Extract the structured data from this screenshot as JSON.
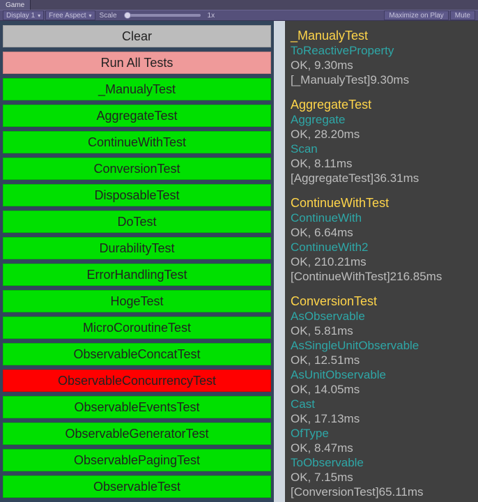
{
  "tabs": {
    "game_label": "Game"
  },
  "toolbar": {
    "display": "Display 1",
    "aspect": "Free Aspect",
    "scale_label": "Scale",
    "scale_value": "1x",
    "maximize": "Maximize on Play",
    "mute": "Mute"
  },
  "buttons": {
    "clear": "Clear",
    "run_all": "Run All Tests"
  },
  "tests": [
    {
      "label": "_ManualyTest",
      "status": "green"
    },
    {
      "label": "AggregateTest",
      "status": "green"
    },
    {
      "label": "ContinueWithTest",
      "status": "green"
    },
    {
      "label": "ConversionTest",
      "status": "green"
    },
    {
      "label": "DisposableTest",
      "status": "green"
    },
    {
      "label": "DoTest",
      "status": "green"
    },
    {
      "label": "DurabilityTest",
      "status": "green"
    },
    {
      "label": "ErrorHandlingTest",
      "status": "green"
    },
    {
      "label": "HogeTest",
      "status": "green"
    },
    {
      "label": "MicroCoroutineTest",
      "status": "green"
    },
    {
      "label": "ObservableConcatTest",
      "status": "green"
    },
    {
      "label": "ObservableConcurrencyTest",
      "status": "red"
    },
    {
      "label": "ObservableEventsTest",
      "status": "green"
    },
    {
      "label": "ObservableGeneratorTest",
      "status": "green"
    },
    {
      "label": "ObservablePagingTest",
      "status": "green"
    },
    {
      "label": "ObservableTest",
      "status": "green"
    }
  ],
  "log": [
    {
      "suite": "_ManualyTest",
      "cases": [
        {
          "name": "ToReactiveProperty",
          "result": "OK, 9.30ms"
        }
      ],
      "summary": "[_ManualyTest]9.30ms"
    },
    {
      "suite": "AggregateTest",
      "cases": [
        {
          "name": "Aggregate",
          "result": "OK, 28.20ms"
        },
        {
          "name": "Scan",
          "result": "OK, 8.11ms"
        }
      ],
      "summary": "[AggregateTest]36.31ms"
    },
    {
      "suite": "ContinueWithTest",
      "cases": [
        {
          "name": "ContinueWith",
          "result": "OK, 6.64ms"
        },
        {
          "name": "ContinueWith2",
          "result": "OK, 210.21ms"
        }
      ],
      "summary": "[ContinueWithTest]216.85ms"
    },
    {
      "suite": "ConversionTest",
      "cases": [
        {
          "name": "AsObservable",
          "result": "OK, 5.81ms"
        },
        {
          "name": "AsSingleUnitObservable",
          "result": "OK, 12.51ms"
        },
        {
          "name": "AsUnitObservable",
          "result": "OK, 14.05ms"
        },
        {
          "name": "Cast",
          "result": "OK, 17.13ms"
        },
        {
          "name": "OfType",
          "result": "OK, 8.47ms"
        },
        {
          "name": "ToObservable",
          "result": "OK, 7.15ms"
        }
      ],
      "summary": "[ConversionTest]65.11ms"
    }
  ]
}
